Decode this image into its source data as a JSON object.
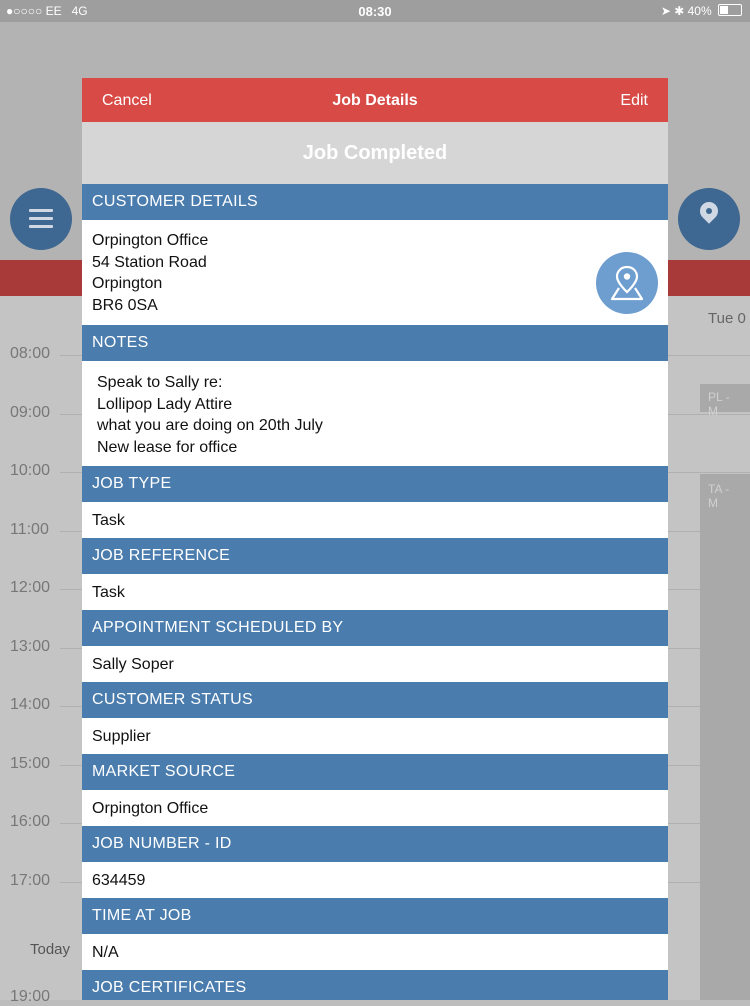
{
  "status_bar": {
    "carrier": "●○○○○ EE",
    "network": "4G",
    "time": "08:30",
    "battery": "40%"
  },
  "background": {
    "day_label": "Tue 0",
    "hours": [
      "08:00",
      "09:00",
      "10:00",
      "11:00",
      "12:00",
      "13:00",
      "14:00",
      "15:00",
      "16:00",
      "17:00",
      "19:00"
    ],
    "event_labels": [
      "PL - M",
      "TA - M"
    ],
    "today_label": "Today"
  },
  "modal": {
    "cancel_label": "Cancel",
    "title": "Job Details",
    "edit_label": "Edit",
    "status": "Job Completed",
    "sections": {
      "customer_details": {
        "heading": "CUSTOMER DETAILS",
        "lines": [
          "Orpington Office",
          "54 Station Road",
          "Orpington",
          "BR6 0SA"
        ]
      },
      "notes": {
        "heading": "NOTES",
        "lines": [
          "Speak to Sally re:",
          "Lollipop Lady Attire",
          "what you are doing on 20th July",
          "New lease for office"
        ]
      },
      "job_type": {
        "heading": "JOB TYPE",
        "value": "Task"
      },
      "job_reference": {
        "heading": "JOB REFERENCE",
        "value": "Task"
      },
      "scheduled_by": {
        "heading": "APPOINTMENT SCHEDULED BY",
        "value": "Sally Soper"
      },
      "customer_status": {
        "heading": "CUSTOMER STATUS",
        "value": "Supplier"
      },
      "market_source": {
        "heading": "MARKET SOURCE",
        "value": "Orpington Office"
      },
      "job_number": {
        "heading": "JOB NUMBER - ID",
        "value": "634459"
      },
      "time_at_job": {
        "heading": "TIME AT JOB",
        "value": "N/A"
      },
      "job_certificates": {
        "heading": "JOB CERTIFICATES"
      }
    }
  },
  "colors": {
    "nav_red": "#d84a45",
    "section_blue": "#4a7cad",
    "banner_gray": "#d6d6d6"
  }
}
